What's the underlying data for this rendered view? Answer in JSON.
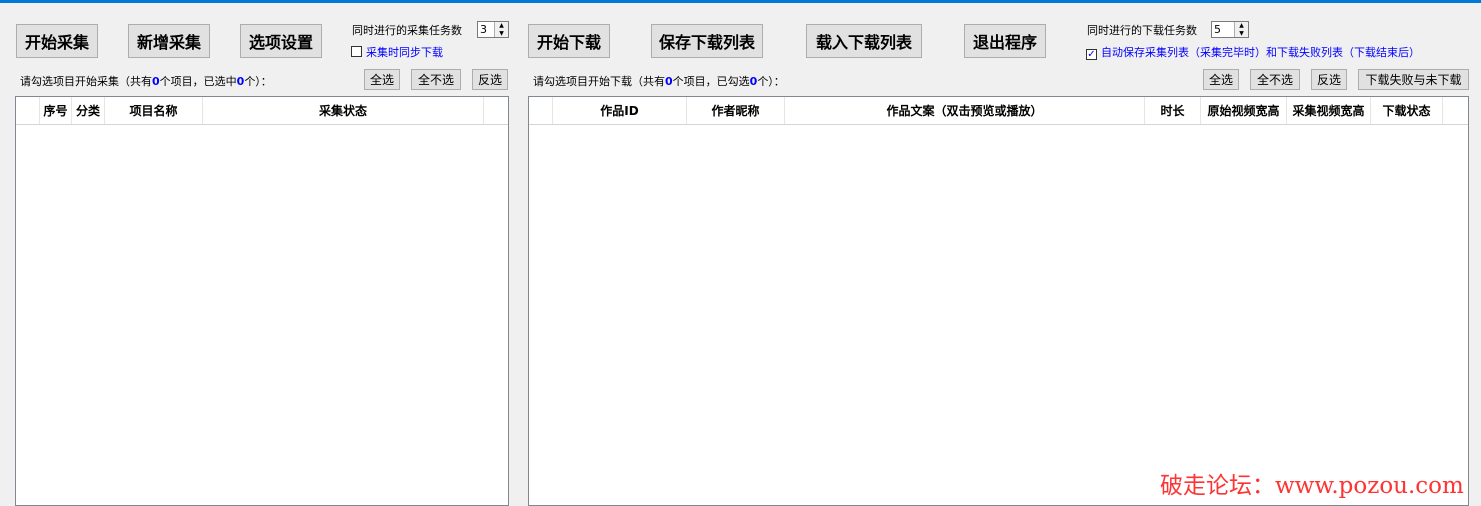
{
  "left": {
    "buttons": {
      "start_collect": "开始采集",
      "add_collect": "新增采集",
      "options": "选项设置"
    },
    "concurrent_label": "同时进行的采集任务数",
    "concurrent_value": "3",
    "sync_download_label": "采集时同步下载",
    "sync_download_checked": false,
    "status": {
      "prefix": "请勾选项目开始采集（共有",
      "total": "0",
      "middle": "个项目，已选中",
      "selected": "0",
      "suffix": "个）："
    },
    "select_all": "全选",
    "select_none": "全不选",
    "invert": "反选",
    "columns": [
      "序号",
      "分类",
      "项目名称",
      "采集状态"
    ]
  },
  "right": {
    "buttons": {
      "start_download": "开始下载",
      "save_list": "保存下载列表",
      "load_list": "载入下载列表",
      "exit": "退出程序"
    },
    "concurrent_label": "同时进行的下载任务数",
    "concurrent_value": "5",
    "autosave_label": "自动保存采集列表（采集完毕时）和下载失败列表（下载结束后）",
    "autosave_checked": true,
    "status": {
      "prefix": "请勾选项目开始下载（共有",
      "total": "0",
      "middle": "个项目，已勾选",
      "selected": "0",
      "suffix": "个）："
    },
    "select_all": "全选",
    "select_none": "全不选",
    "invert": "反选",
    "fail_undownloaded": "下载失败与未下载",
    "columns": [
      "作品ID",
      "作者昵称",
      "作品文案（双击预览或播放）",
      "时长",
      "原始视频宽高",
      "采集视频宽高",
      "下载状态"
    ]
  },
  "watermark": "破走论坛：www.pozou.com"
}
